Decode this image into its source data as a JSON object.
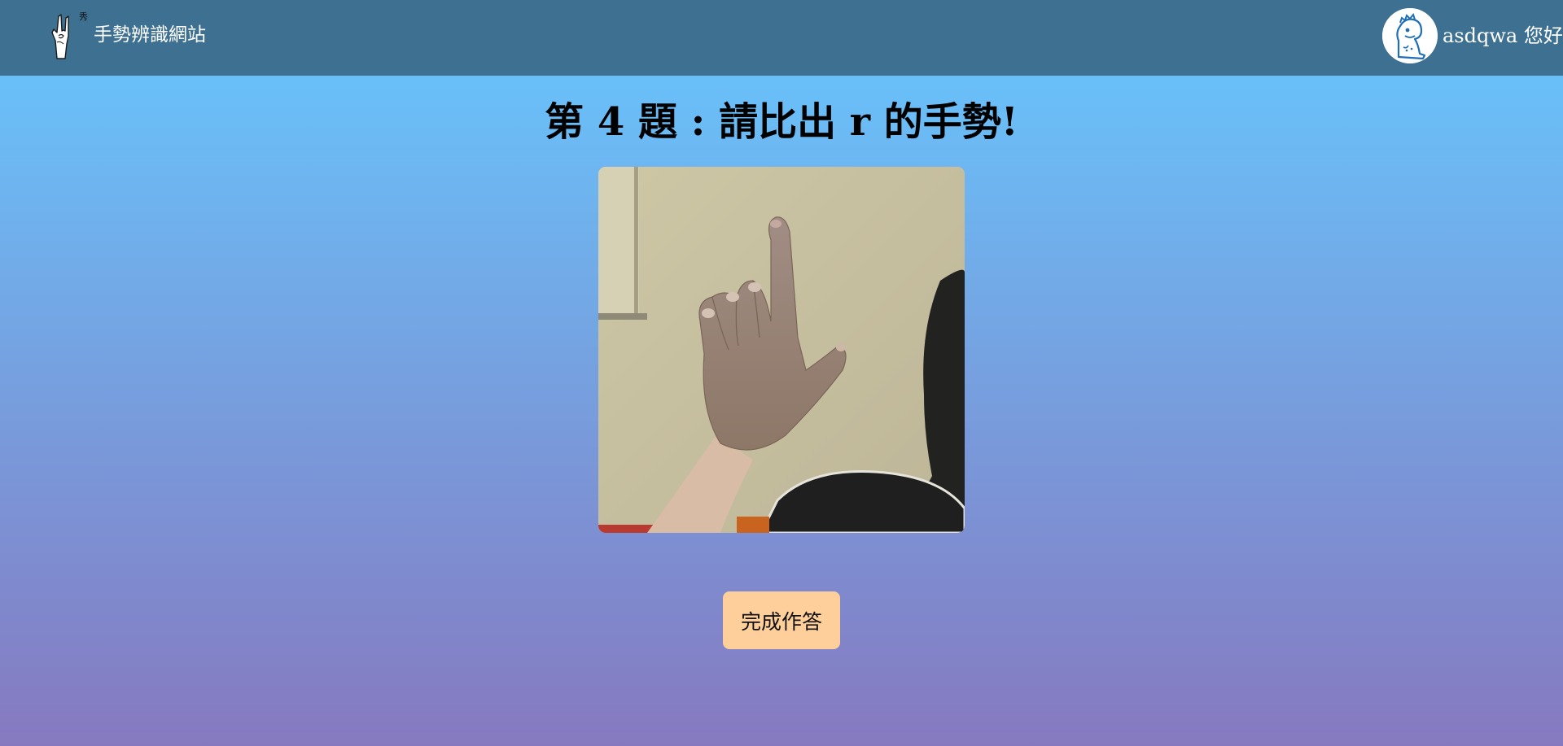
{
  "header": {
    "brand_name": "手勢辨識網站",
    "logo_icon": "rock-hand-gesture-icon",
    "logo_caption": "秀",
    "avatar_icon": "dinosaur-avatar-icon",
    "greeting": "asdqwa 您好"
  },
  "main": {
    "question_title": "第 4 題 : 請比出 r 的手勢!",
    "camera_feed_icon": "webcam-hand-image",
    "submit_label": "完成作答"
  },
  "colors": {
    "navbar": "#3e7191",
    "gradient_top": "#69c0f9",
    "gradient_bottom": "#8679c0",
    "button": "#ffcf9b"
  }
}
